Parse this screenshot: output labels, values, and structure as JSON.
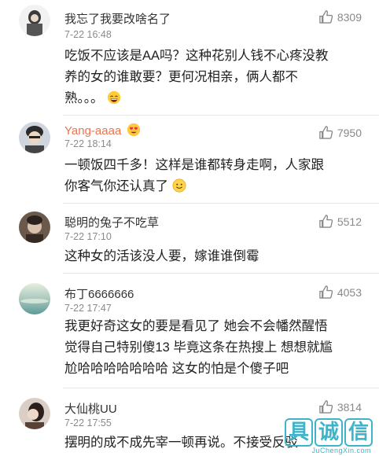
{
  "comments": [
    {
      "username": "我忘了我要改啥名了",
      "time": "7-22 16:48",
      "likes": "8309",
      "lines": [
        "吃饭不应该是AA吗？这种花别人钱不心疼没教",
        "养的女的谁敢要？更何况相亲，俩人都不",
        "熟。。。"
      ],
      "emoji": "laughing-emoji"
    },
    {
      "username": "Yang-aaaa",
      "time": "7-22 18:14",
      "likes": "7950",
      "lines": [
        "一顿饭四千多！这样是谁都转身走啊，人家跟",
        "你客气你还认真了"
      ],
      "emoji": "smile-emoji",
      "badge": "heart-eyes-badge"
    },
    {
      "username": "聪明的兔子不吃草",
      "time": "7-22 17:10",
      "likes": "5512",
      "lines": [
        "这种女的活该没人要，嫁谁谁倒霉"
      ]
    },
    {
      "username": "布丁6666666",
      "time": "7-22 17:47",
      "likes": "4053",
      "lines": [
        "我更好奇这女的要是看见了 她会不会幡然醒悟",
        "觉得自己特别傻13 毕竟这条在热搜上 想想就尴",
        "尬哈哈哈哈哈哈哈 这女的怕是个傻子吧"
      ]
    },
    {
      "username": "大仙桃UU",
      "time": "7-22 17:55",
      "likes": "3814",
      "lines": [
        "摆明的成不成先宰一顿再说。不接受反驳"
      ]
    }
  ],
  "watermark": {
    "chars": [
      "具",
      "诚",
      "信"
    ],
    "url": "JuChengXin.com"
  },
  "colors": {
    "username_highlight": "#eb7350",
    "meta_gray": "#8a8a8a",
    "watermark": "#3fb3c8"
  }
}
